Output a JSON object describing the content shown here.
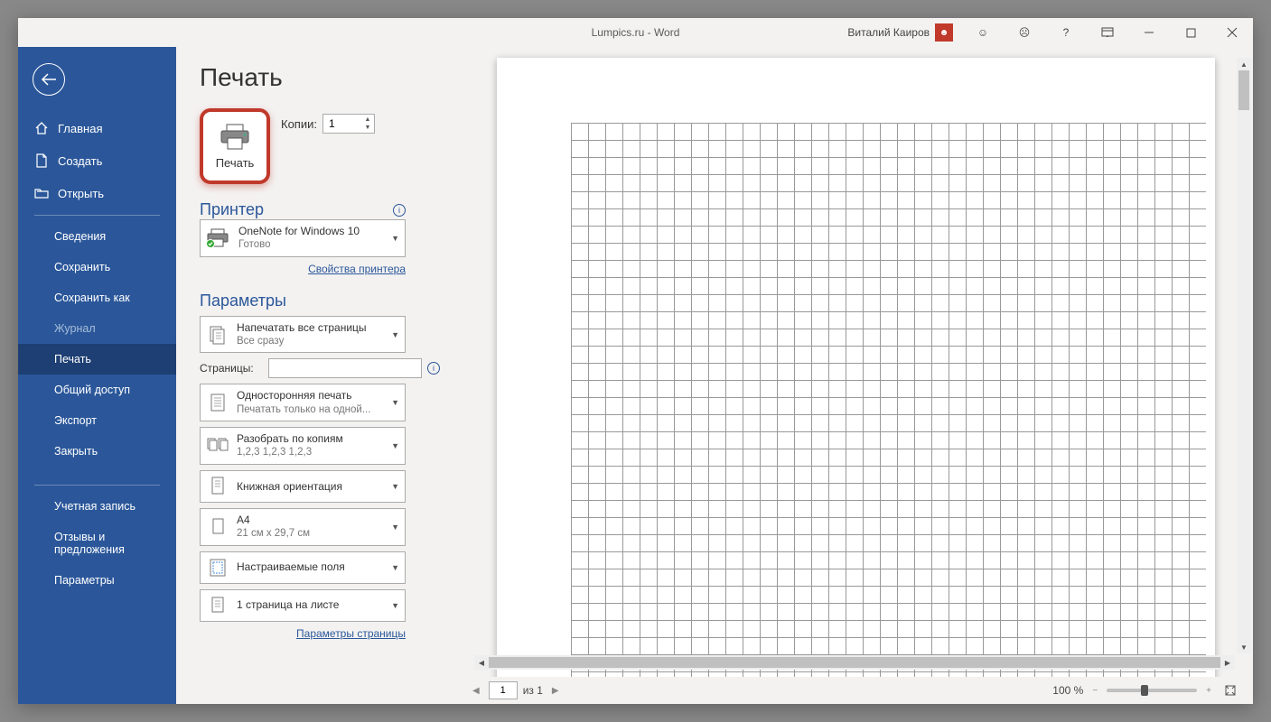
{
  "window": {
    "title": "Lumpics.ru  -  Word",
    "user": "Виталий Каиров"
  },
  "sidebar": {
    "top": [
      {
        "label": "Главная"
      },
      {
        "label": "Создать"
      },
      {
        "label": "Открыть"
      }
    ],
    "mid": [
      {
        "label": "Сведения"
      },
      {
        "label": "Сохранить"
      },
      {
        "label": "Сохранить как"
      },
      {
        "label": "Журнал",
        "dim": true
      },
      {
        "label": "Печать",
        "active": true
      },
      {
        "label": "Общий доступ"
      },
      {
        "label": "Экспорт"
      },
      {
        "label": "Закрыть"
      }
    ],
    "bottom": [
      {
        "label": "Учетная запись"
      },
      {
        "label": "Отзывы и предложения"
      },
      {
        "label": "Параметры"
      }
    ]
  },
  "page": {
    "title": "Печать",
    "print_button": "Печать",
    "copies_label": "Копии:",
    "copies_value": "1",
    "printer_heading": "Принтер",
    "printer_name": "OneNote for Windows 10",
    "printer_status": "Готово",
    "printer_props": "Свойства принтера",
    "params_heading": "Параметры",
    "param_all_pages": "Напечатать все страницы",
    "param_all_pages_sub": "Все сразу",
    "pages_label": "Страницы:",
    "param_oneside": "Односторонняя печать",
    "param_oneside_sub": "Печатать только на одной...",
    "param_collate": "Разобрать по копиям",
    "param_collate_sub": "1,2,3    1,2,3    1,2,3",
    "param_orient": "Книжная ориентация",
    "param_size": "A4",
    "param_size_sub": "21 см x 29,7 см",
    "param_margins": "Настраиваемые поля",
    "param_perpage": "1 страница на листе",
    "page_setup": "Параметры страницы"
  },
  "footer": {
    "page_current": "1",
    "page_of": "из 1",
    "zoom": "100 %"
  }
}
